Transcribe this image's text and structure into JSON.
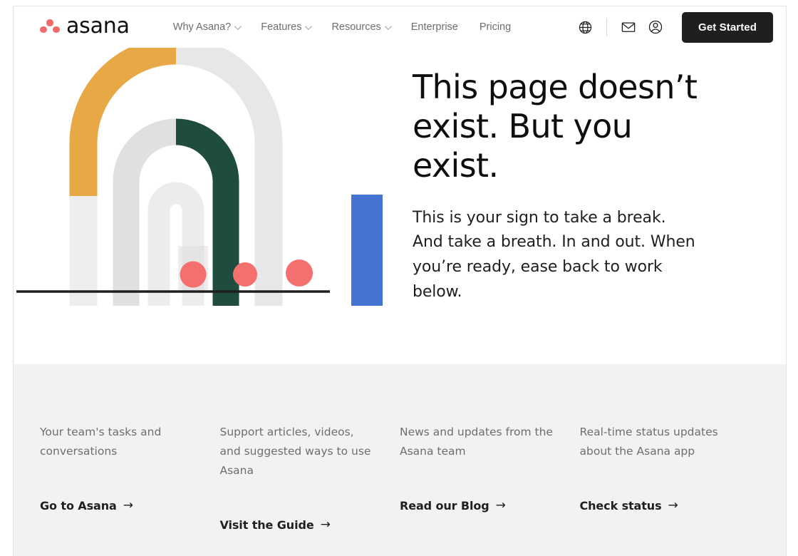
{
  "brand": {
    "word": "asana",
    "logo_dot_color": "#f06a6a"
  },
  "header": {
    "nav": [
      {
        "label": "Why Asana?",
        "has_chevron": true
      },
      {
        "label": "Features",
        "has_chevron": true
      },
      {
        "label": "Resources",
        "has_chevron": true
      },
      {
        "label": "Enterprise",
        "has_chevron": false
      },
      {
        "label": "Pricing",
        "has_chevron": false
      }
    ],
    "icons": [
      {
        "name": "globe-icon",
        "title": "Language"
      },
      {
        "name": "envelope-icon",
        "title": "Contact sales"
      },
      {
        "name": "user-account-icon",
        "title": "Log in"
      }
    ],
    "cta_label": "Get Started",
    "cta_bg": "#1e1f21"
  },
  "hero": {
    "title": "This page doesn’t exist. But you exist.",
    "subtitle": "This is your sign to take a break. And take a breath. In and out. When you’re ready, ease back to work below.",
    "illustration": {
      "name": "concentric-arches-illustration",
      "colors": {
        "yellow": "#e8a845",
        "green": "#1e4d3f",
        "blue": "#4573d2",
        "light_gray": "#ececec",
        "mid_gray": "#e0e0e0",
        "pale_gray": "#e7e7ea",
        "dot": "#f4706e",
        "baseline": "#1e1f21"
      }
    }
  },
  "footer": {
    "bg": "#f3f2f1",
    "columns": [
      {
        "description": "Your team's tasks and conversations",
        "link_label": "Go to Asana",
        "arrow": "→"
      },
      {
        "description": "Support articles, videos, and suggested ways to use Asana",
        "link_label": "Visit the Guide",
        "arrow": "→"
      },
      {
        "description": "News and updates from the Asana team",
        "link_label": "Read our Blog",
        "arrow": "→"
      },
      {
        "description": "Real-time status updates about the Asana app",
        "link_label": "Check status",
        "arrow": "→"
      }
    ]
  }
}
